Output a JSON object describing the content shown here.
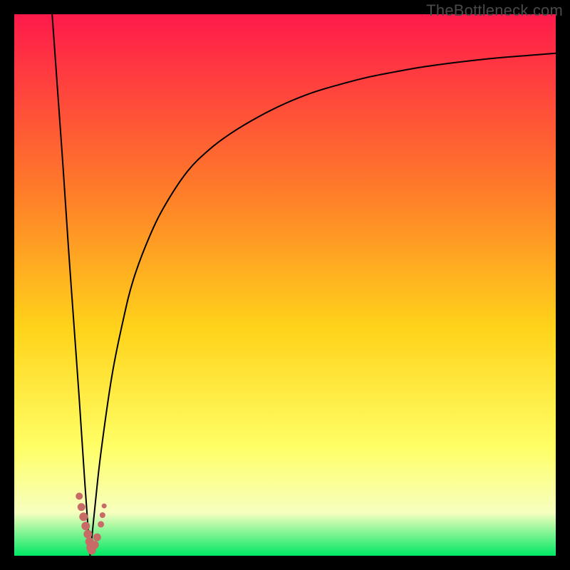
{
  "watermark": "TheBottleneck.com",
  "colors": {
    "frame": "#000000",
    "grad_top": "#ff1a4b",
    "grad_mid1": "#ff7a2a",
    "grad_mid2": "#ffd31a",
    "grad_mid3": "#ffff66",
    "grad_band": "#f7ffbf",
    "grad_bottom": "#00e864",
    "curve": "#000000",
    "marker_fill": "#c86a66",
    "marker_stroke": "#c86a66"
  },
  "chart_data": {
    "type": "line",
    "title": "",
    "xlabel": "",
    "ylabel": "",
    "xlim": [
      0,
      100
    ],
    "ylim": [
      0,
      100
    ],
    "notes": "Bottleneck curve: steep descending line and asymptotic rising curve meeting near x≈14%, y≈0. Background gradient encodes bottleneck severity (red high, green low).",
    "series": [
      {
        "name": "descending",
        "x": [
          7,
          8,
          9,
          10,
          11,
          12,
          13,
          14
        ],
        "values": [
          100,
          86,
          72,
          57,
          43,
          29,
          14,
          0
        ]
      },
      {
        "name": "ascending",
        "x": [
          14,
          15,
          16,
          18,
          20,
          22,
          25,
          28,
          32,
          36,
          40,
          45,
          50,
          55,
          60,
          65,
          70,
          75,
          80,
          85,
          90,
          95,
          100
        ],
        "values": [
          0,
          10,
          19,
          33,
          43,
          51,
          59,
          65,
          71,
          75,
          78,
          81,
          83.5,
          85.5,
          87,
          88.3,
          89.3,
          90.2,
          90.9,
          91.5,
          92,
          92.4,
          92.8
        ]
      }
    ],
    "markers": [
      {
        "x": 12.0,
        "y": 11.0,
        "r": 5.0
      },
      {
        "x": 12.4,
        "y": 9.0,
        "r": 5.5
      },
      {
        "x": 12.8,
        "y": 7.2,
        "r": 6.0
      },
      {
        "x": 13.2,
        "y": 5.5,
        "r": 6.0
      },
      {
        "x": 13.6,
        "y": 4.0,
        "r": 6.0
      },
      {
        "x": 13.9,
        "y": 2.6,
        "r": 6.0
      },
      {
        "x": 14.1,
        "y": 1.5,
        "r": 6.0
      },
      {
        "x": 14.3,
        "y": 1.0,
        "r": 6.0
      },
      {
        "x": 14.9,
        "y": 2.0,
        "r": 5.5
      },
      {
        "x": 15.3,
        "y": 3.4,
        "r": 5.5
      },
      {
        "x": 16.0,
        "y": 5.8,
        "r": 4.5
      },
      {
        "x": 16.3,
        "y": 7.5,
        "r": 4.0
      },
      {
        "x": 16.6,
        "y": 9.2,
        "r": 3.5
      }
    ]
  }
}
